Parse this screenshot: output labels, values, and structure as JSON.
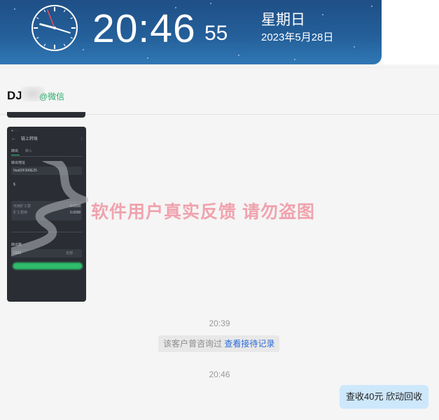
{
  "clock_banner": {
    "time": "20:46",
    "seconds": "55",
    "weekday": "星期日",
    "date": "2023年5月28日",
    "accent": "#245f99"
  },
  "chat": {
    "contact_name": "DJ",
    "channel_label": "@微信",
    "channel_color": "#2bae6a",
    "screenshot": {
      "header_title": "链上转账",
      "tab_send": "转出",
      "tab_receive": "转入",
      "address_label": "转出地址",
      "address_value": "0xa92F306E25",
      "fee_label1": "可用矿工费",
      "fee_value1": "0.0000",
      "fee_label2": "矿工费用",
      "fee_value2": "0.0000",
      "amount_label": "转出数",
      "amount_value": "2200",
      "amount_btn": "全部"
    },
    "watermark": "软件用户真实反馈  请勿盗图",
    "timestamp1": "20:39",
    "system_note": "该客户曾咨询过",
    "system_link": "查看接待记录",
    "timestamp2": "20:46",
    "outgoing_message": "查收40元  欣动回收"
  }
}
